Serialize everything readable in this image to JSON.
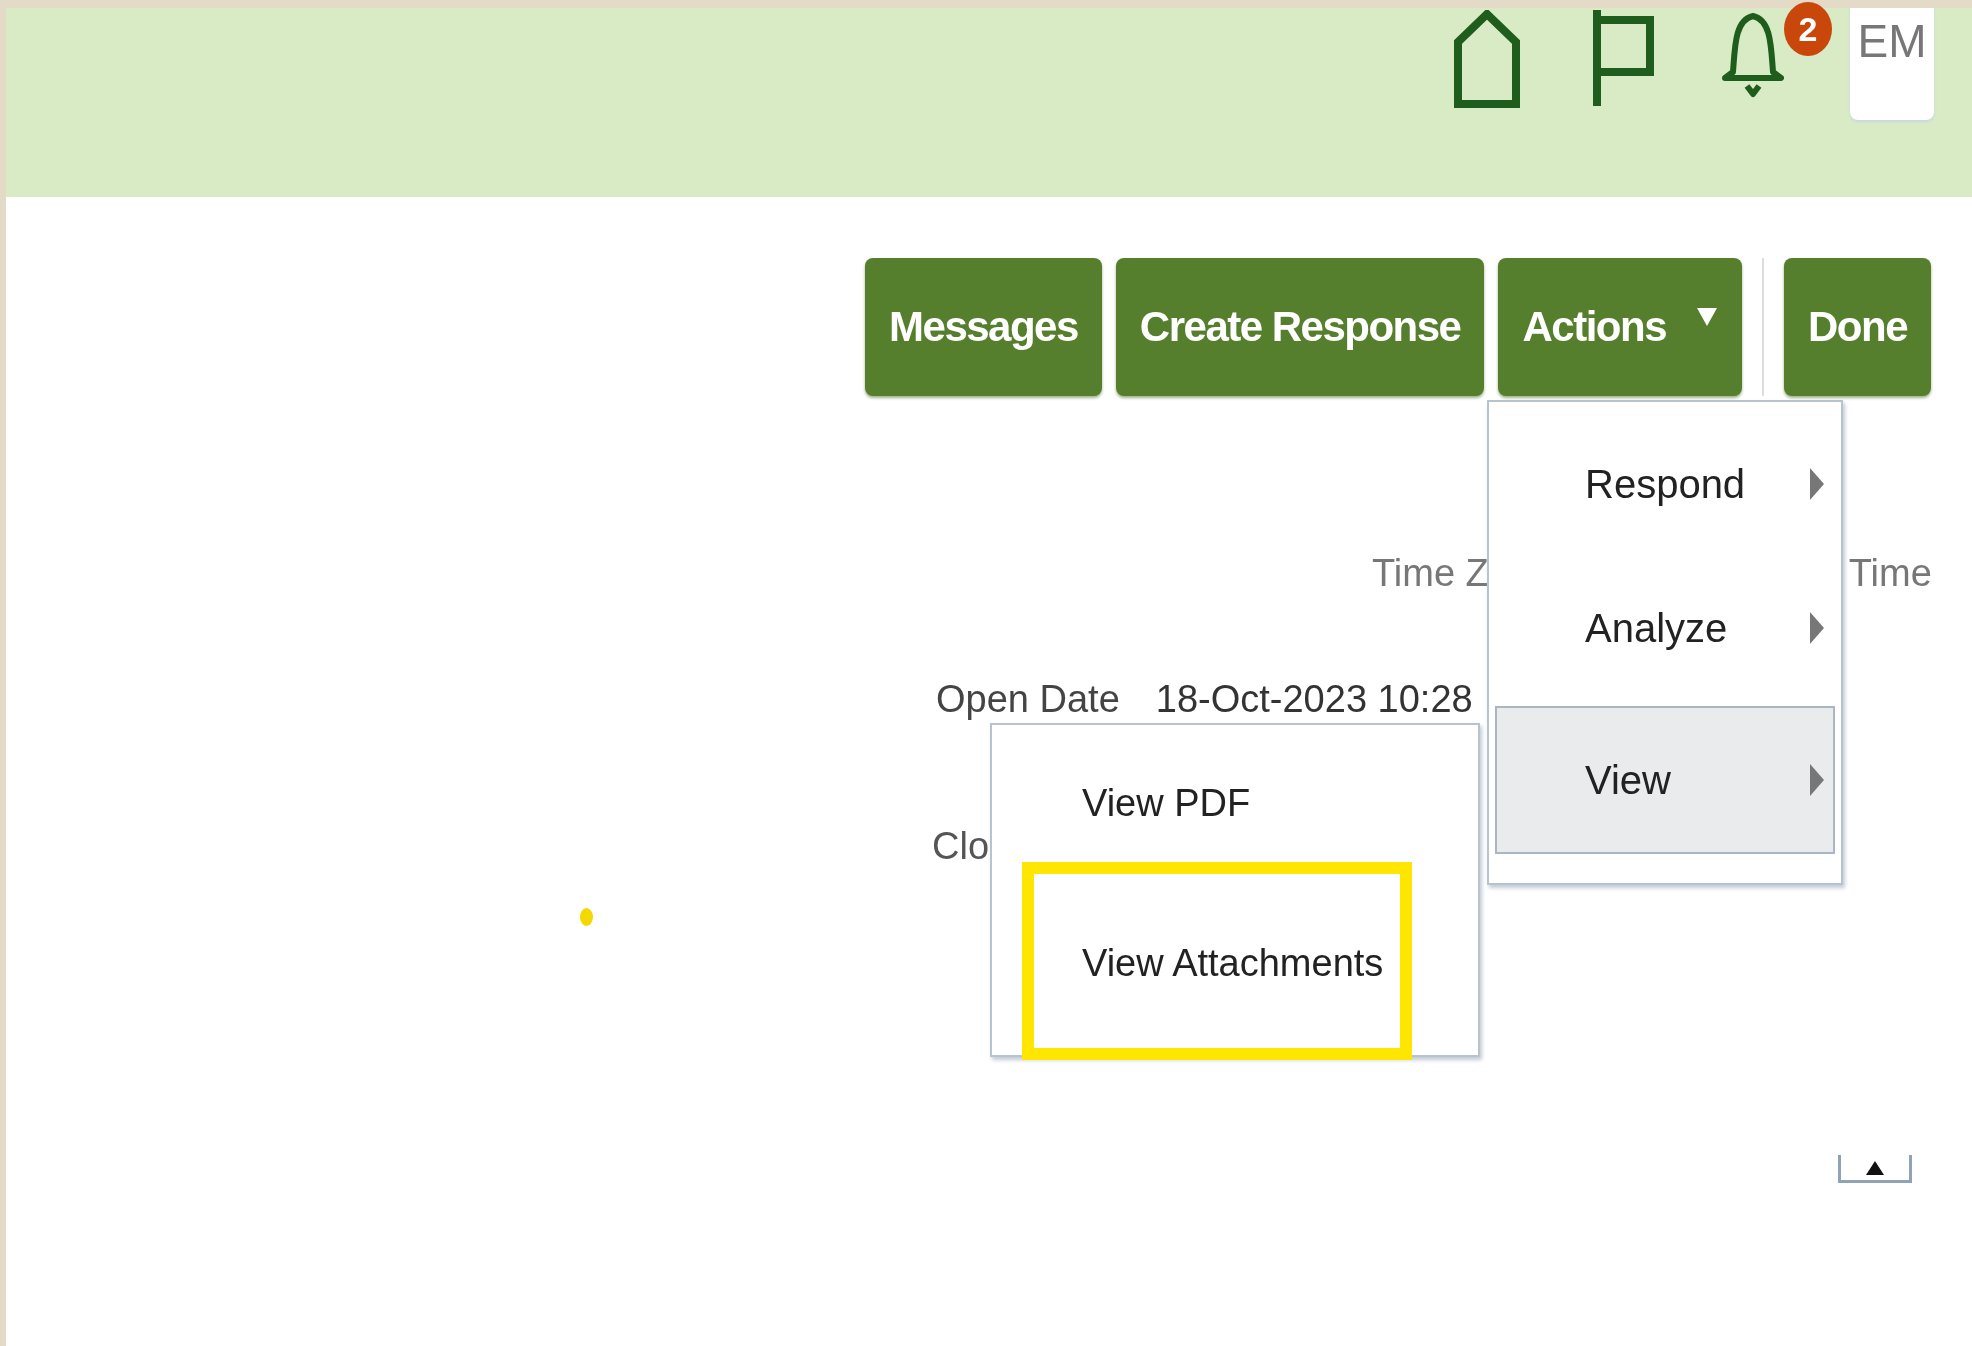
{
  "header": {
    "icons": [
      {
        "kind": "home"
      },
      {
        "kind": "flag"
      },
      {
        "kind": "bell",
        "badge": "2"
      }
    ],
    "user": {
      "initials": "EM"
    }
  },
  "toolbar": {
    "buttons": [
      {
        "label": "Messages"
      },
      {
        "label": "Create Response"
      },
      {
        "label": "Actions",
        "dropdown": true,
        "expanded": true
      },
      {
        "label": "Done"
      }
    ]
  },
  "details": {
    "time_zone_label": "Time Z",
    "time_label": "Time",
    "fields": [
      {
        "label": "Open Date",
        "value": "18-Oct-2023 10:28"
      },
      {
        "label": "Clo"
      }
    ]
  },
  "actions_menu": {
    "items": [
      {
        "label": "Respond",
        "submenu": true,
        "selected": false
      },
      {
        "label": "Analyze",
        "submenu": true,
        "selected": false
      },
      {
        "label": "View",
        "submenu": true,
        "selected": true
      }
    ]
  },
  "view_submenu": {
    "items": [
      {
        "label": "View PDF",
        "highlighted": false
      },
      {
        "label": "View Attachments",
        "highlighted": true
      }
    ]
  }
}
